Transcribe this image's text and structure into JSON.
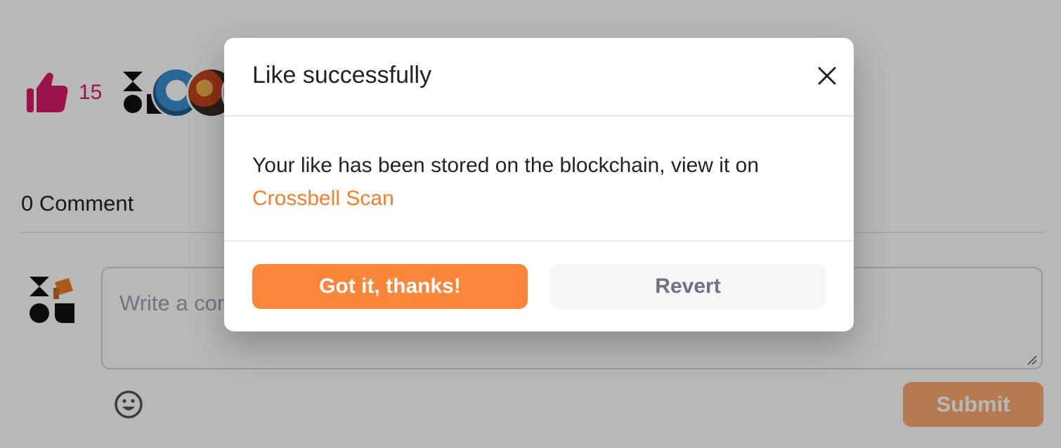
{
  "post": {
    "like_count": "15",
    "comment_count_label": "0 Comment",
    "comment_placeholder": "Write a comment...",
    "submit_label": "Submit",
    "colors": {
      "like": "#d61b6a",
      "accent": "#fb8538"
    },
    "icons": {
      "like": "thumbs-up-icon",
      "emoji": "smiley-icon",
      "avatar": "xlog-logo"
    }
  },
  "modal": {
    "title": "Like successfully",
    "message": "Your like has been stored on the blockchain, view it on",
    "link_text": "Crossbell Scan",
    "primary_label": "Got it, thanks!",
    "secondary_label": "Revert",
    "close_icon": "close-icon"
  }
}
